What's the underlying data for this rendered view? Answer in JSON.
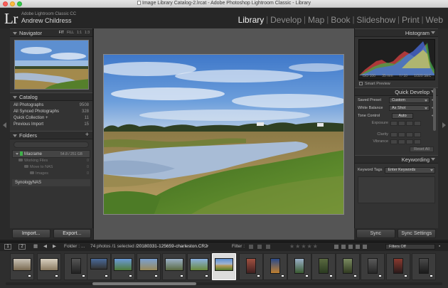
{
  "window": {
    "title": "Image Library Catalog-2.lrcat - Adobe Photoshop Lightroom Classic - Library"
  },
  "identity": {
    "logo": "Lr",
    "app_name": "Adobe Lightroom Classic CC",
    "user_name": "Andrew Childress"
  },
  "modules": [
    "Library",
    "Develop",
    "Map",
    "Book",
    "Slideshow",
    "Print",
    "Web"
  ],
  "navigator": {
    "title": "Navigator",
    "zooms": [
      "FIT",
      "FILL",
      "1:1",
      "1:3"
    ]
  },
  "catalog": {
    "title": "Catalog",
    "items": [
      {
        "label": "All Photographs",
        "count": "9508"
      },
      {
        "label": "All Synced Photographs",
        "count": "328"
      },
      {
        "label": "Quick Collection +",
        "count": "11"
      },
      {
        "label": "Previous Import",
        "count": "15"
      }
    ]
  },
  "folders": {
    "title": "Folders",
    "volume": {
      "name": "Macrame",
      "capacity": "54.8 / 251 GB"
    },
    "items": [
      {
        "label": "Working Files",
        "count": "0"
      },
      {
        "label": "Move to NAS",
        "count": "0"
      },
      {
        "label": "Images",
        "count": "0"
      }
    ],
    "nas": {
      "name": "SynologyNAS"
    }
  },
  "left_buttons": {
    "import": "Import...",
    "export": "Export..."
  },
  "histogram": {
    "title": "Histogram",
    "info": [
      "ISO 100",
      "35 mm",
      "f / 10",
      "1/320 SEC"
    ],
    "original_photo": "Smart Preview"
  },
  "quick_develop": {
    "title": "Quick Develop",
    "saved_preset_label": "Saved Preset",
    "saved_preset_value": "Custom",
    "white_balance_label": "White Balance",
    "white_balance_value": "As Shot",
    "tone_control_label": "Tone Control",
    "auto_label": "Auto",
    "adjustments": [
      "Exposure",
      "Clarity",
      "Vibrance"
    ],
    "reset_label": "Reset All"
  },
  "keywording": {
    "title": "Keywording",
    "tags_label": "Keyword Tags",
    "tags_value": "Enter Keywords"
  },
  "right_buttons": {
    "sync": "Sync",
    "sync_settings": "Sync Settings"
  },
  "filmstrip_bar": {
    "view1": "1",
    "view2": "2",
    "source": "Folder : ...",
    "status": "74 photos /1 selected /",
    "filename": "20180331-125659-charleston.CR2",
    "filter_label": "Filter :",
    "filters_off": "Filters Off"
  },
  "colors": {
    "panel": "#333333",
    "center": "#555555",
    "sky": "#5b8fd4",
    "water": "#9fb4cf",
    "grass": "#4f7b2a",
    "marsh": "#b79a5a"
  }
}
